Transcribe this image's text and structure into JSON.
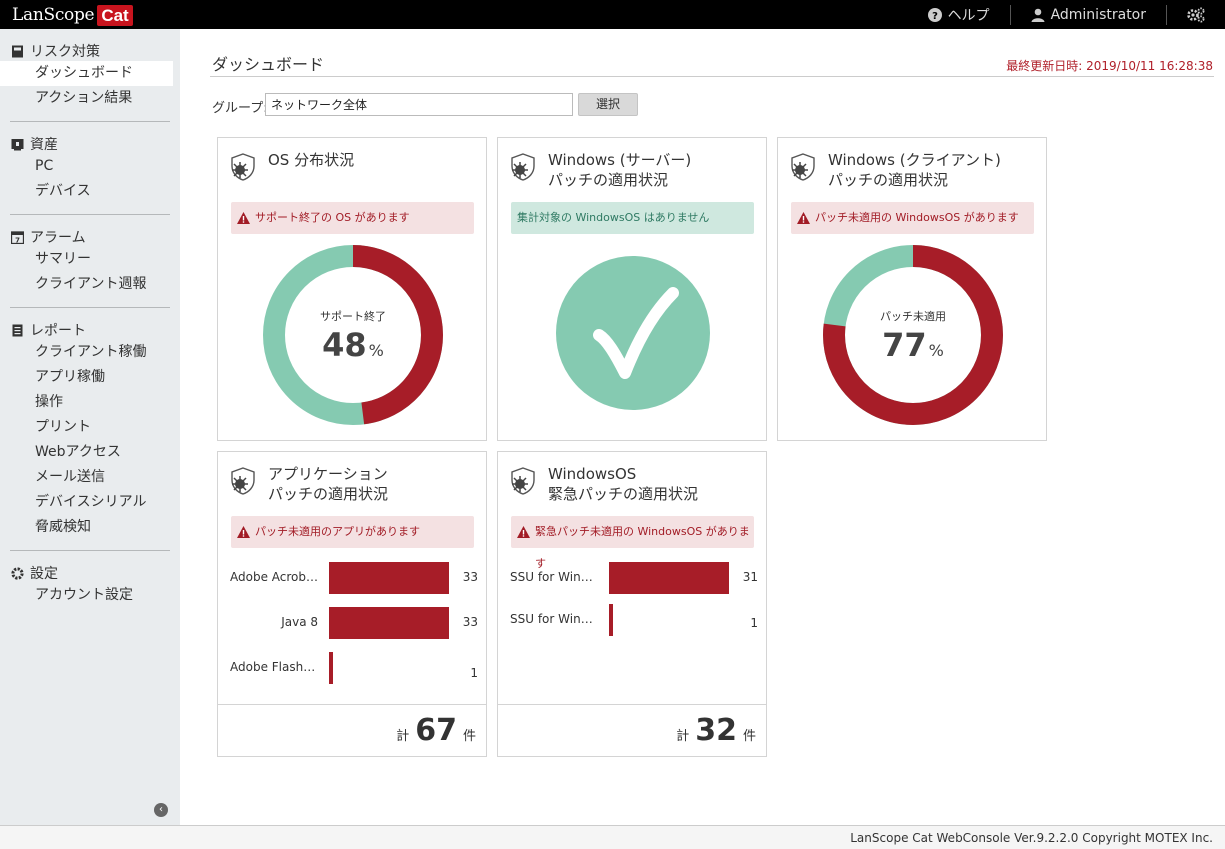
{
  "brand": {
    "name": "LanScope",
    "badge": "Cat"
  },
  "topbar": {
    "help": "ヘルプ",
    "user": "Administrator"
  },
  "sidebar": {
    "sections": [
      {
        "title": "リスク対策",
        "items": [
          "ダッシュボード",
          "アクション結果"
        ]
      },
      {
        "title": "資産",
        "items": [
          "PC",
          "デバイス"
        ]
      },
      {
        "title": "アラーム",
        "items": [
          "サマリー",
          "クライアント週報"
        ]
      },
      {
        "title": "レポート",
        "items": [
          "クライアント稼働",
          "アプリ稼働",
          "操作",
          "プリント",
          "Webアクセス",
          "メール送信",
          "デバイスシリアル",
          "脅威検知"
        ]
      },
      {
        "title": "設定",
        "items": [
          "アカウント設定"
        ]
      }
    ],
    "active": "ダッシュボード",
    "collapse_glyph": "‹"
  },
  "main": {
    "title": "ダッシュボード",
    "updated": "最終更新日時: 2019/10/11 16:28:38",
    "group_label": "グループ:",
    "group_value": "ネットワーク全体",
    "select_label": "選択"
  },
  "cards": {
    "os": {
      "title_line1": "OS 分布状況",
      "alert": "サポート終了の OS があります",
      "donut_label": "サポート終了",
      "donut_value": "48",
      "donut_unit": "%",
      "fraction": 0.48
    },
    "server": {
      "title_line1": "Windows (サーバー)",
      "title_line2": "パッチの適用状況",
      "alert": "集計対象の WindowsOS はありません"
    },
    "client": {
      "title_line1": "Windows (クライアント)",
      "title_line2": "パッチの適用状況",
      "alert": "パッチ未適用の WindowsOS があります",
      "donut_label": "パッチ未適用",
      "donut_value": "77",
      "donut_unit": "%",
      "fraction": 0.77
    },
    "apps": {
      "title_line1": "アプリケーション",
      "title_line2": "パッチの適用状況",
      "alert": "パッチ未適用のアプリがあります",
      "bars": [
        {
          "label": "Adobe Acrob…",
          "value": 33,
          "value_text": "33"
        },
        {
          "label": "Java 8",
          "value": 33,
          "value_text": "33"
        },
        {
          "label": "Adobe Flash …",
          "value": 1,
          "value_text": "1"
        }
      ],
      "max": 33,
      "total_prefix": "計",
      "total": "67",
      "total_suffix": "件"
    },
    "winos": {
      "title_line1": "WindowsOS",
      "title_line2": "緊急パッチの適用状況",
      "alert": "緊急パッチ未適用の WindowsOS があります",
      "bars": [
        {
          "label": "SSU for Win…",
          "value": 31,
          "value_text": "31"
        },
        {
          "label": "SSU for Win…",
          "value": 1,
          "value_text": "1"
        }
      ],
      "max": 31,
      "total_prefix": "計",
      "total": "32",
      "total_suffix": "件"
    }
  },
  "colors": {
    "danger": "#a71d28",
    "ok": "#85cab1",
    "alert_bg": "#f4e1e2",
    "ok_bg": "#cfe8df"
  },
  "footer": "LanScope Cat WebConsole Ver.9.2.2.0 Copyright MOTEX Inc."
}
